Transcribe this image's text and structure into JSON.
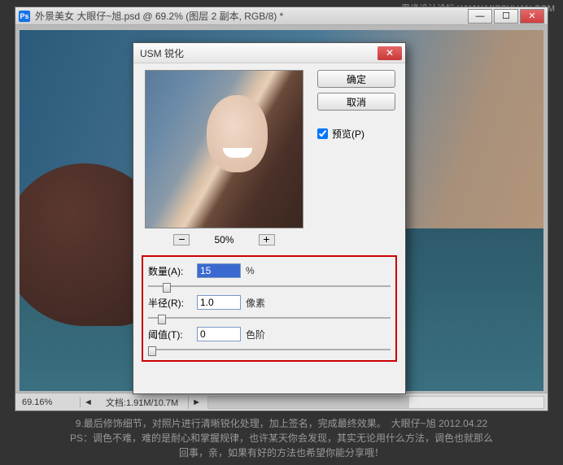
{
  "watermark": "思缘设计论坛 WWW.MISSYUAN.COM",
  "ps": {
    "icon": "Ps",
    "title": "外景美女 大眼仔~旭.psd @ 69.2% (图层 2 副本, RGB/8) *",
    "min": "—",
    "max": "☐",
    "close": "✕",
    "zoom": "69.16%",
    "docinfo": "文档:1.91M/10.7M",
    "scroll_l": "◄",
    "scroll_r": "►"
  },
  "dialog": {
    "title": "USM 锐化",
    "close": "✕",
    "ok": "确定",
    "cancel": "取消",
    "preview_label": "预览(P)",
    "preview_checked": true,
    "zoom_out": "−",
    "zoom_in": "+",
    "zoom_pct": "50%",
    "params": {
      "amount": {
        "label": "数量(A):",
        "value": "15",
        "unit": "%",
        "pos": 6
      },
      "radius": {
        "label": "半径(R):",
        "value": "1.0",
        "unit": "像素",
        "pos": 4
      },
      "threshold": {
        "label": "阈值(T):",
        "value": "0",
        "unit": "色阶",
        "pos": 0
      }
    }
  },
  "caption": {
    "line1": "9.最后修饰细节，对照片进行清晰锐化处理，加上签名，完成最终效果。　大眼仔~旭 2012.04.22",
    "line2": "PS：调色不难，难的是耐心和掌握规律，也许某天你会发现，其实无论用什么方法，调色也就那么",
    "line3": "回事，亲，如果有好的方法也希望你能分享哦！"
  }
}
